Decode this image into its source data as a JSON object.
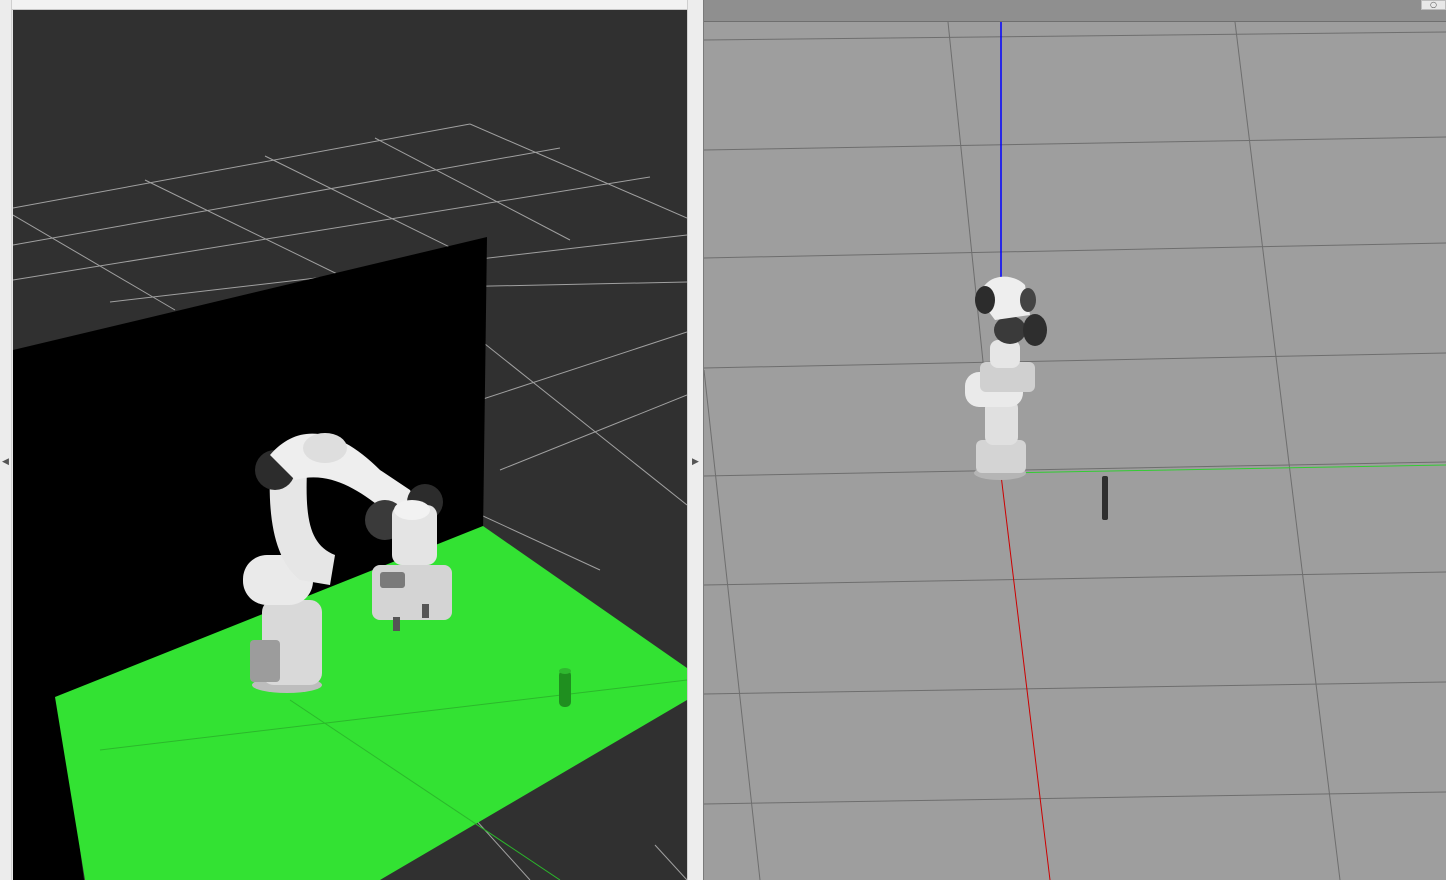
{
  "panels": {
    "left": {
      "name": "rviz-3d-view",
      "collapse_arrow": "◀"
    },
    "splitter": {
      "left_arrow": "◀",
      "right_arrow": "▶"
    },
    "right": {
      "name": "gazebo-3d-view",
      "corner_icon": "circle-icon",
      "corner_glyph": "○"
    }
  },
  "colors": {
    "rviz_background": "#303030",
    "rviz_grid": "#a0a0a0",
    "table_green": "#33e233",
    "wall": "#000000",
    "gazebo_background": "#9e9e9e",
    "gazebo_grid": "#6e6e6e",
    "axis_x": "#cc0000",
    "axis_y": "#33cc33",
    "axis_z": "#0000ff"
  }
}
